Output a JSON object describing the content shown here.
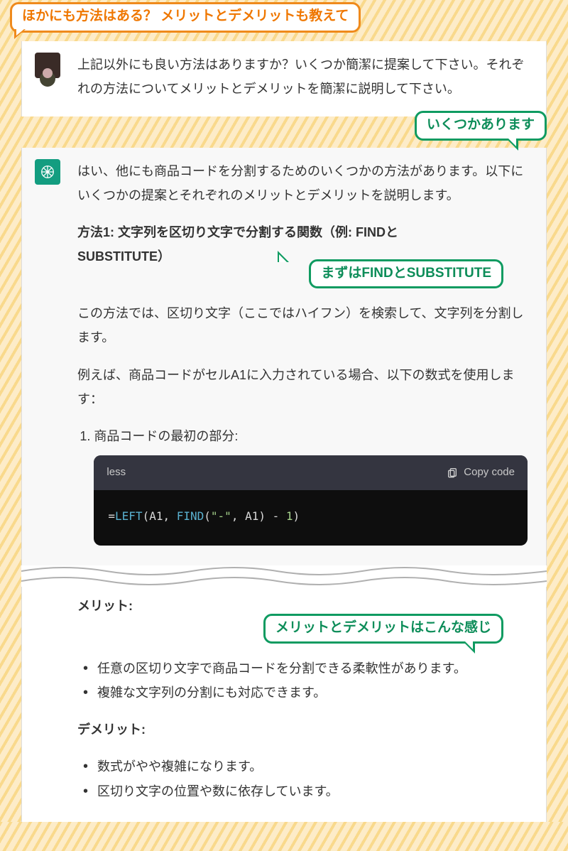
{
  "callouts": {
    "top": "ほかにも方法はある？ メリットとデメリットも教えて",
    "green1": "いくつかあります",
    "green2": "まずはFINDとSUBSTITUTE",
    "green3": "メリットとデメリットはこんな感じ"
  },
  "user_message": "上記以外にも良い方法はありますか？いくつか簡潔に提案して下さい。それぞれの方法についてメリットとデメリットを簡潔に説明して下さい。",
  "ai": {
    "intro": "はい、他にも商品コードを分割するためのいくつかの方法があります。以下にいくつかの提案とそれぞれのメリットとデメリットを説明します。",
    "method1_title_a": "方法1: 文字列を区切り文字で分割する関数（例: FINDと",
    "method1_title_b": "SUBSTITUTE）",
    "method1_desc": "この方法では、区切り文字（ここではハイフン）を検索して、文字列を分割します。",
    "method1_example_lead": "例えば、商品コードがセルA1に入力されている場合、以下の数式を使用します：",
    "list_item_1": "商品コードの最初の部分:",
    "code": {
      "lang": "less",
      "copy_label": "Copy code",
      "tokens": {
        "pre": "=",
        "fn1": "LEFT",
        "p1": "(A1, ",
        "fn2": "FIND",
        "p2": "(",
        "str": "\"-\"",
        "p3": ", A1) - ",
        "num": "1",
        "p4": ")"
      }
    },
    "merits_heading": "メリット:",
    "merits": [
      "任意の区切り文字で商品コードを分割できる柔軟性があります。",
      "複雑な文字列の分割にも対応できます。"
    ],
    "demerits_heading": "デメリット:",
    "demerits": [
      "数式がやや複雑になります。",
      "区切り文字の位置や数に依存しています。"
    ]
  }
}
